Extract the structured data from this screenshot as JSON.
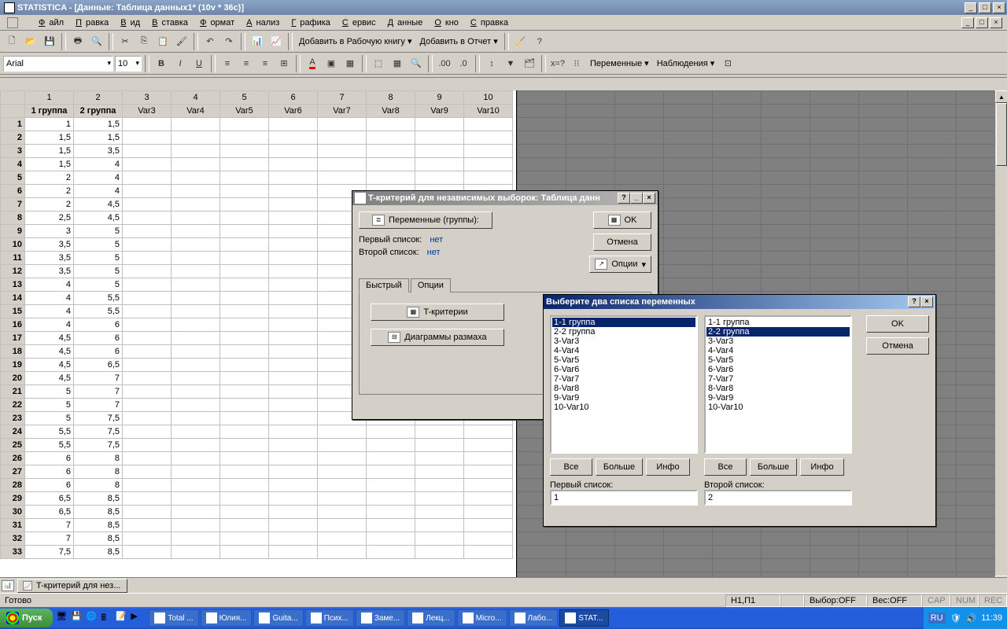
{
  "titlebar": "STATISTICA - [Данные: Таблица данных1* (10v * 36c)]",
  "menubar": [
    "Файл",
    "Правка",
    "Вид",
    "Вставка",
    "Формат",
    "Анализ",
    "Графика",
    "Сервис",
    "Данные",
    "Окно",
    "Справка"
  ],
  "toolbar1": {
    "add_workbook": "Добавить в Рабочую книгу",
    "add_report": "Добавить в Отчет"
  },
  "toolbar2": {
    "font": "Arial",
    "size": "10",
    "vars": "Переменные",
    "obs": "Наблюдения"
  },
  "columns_num": [
    "1",
    "2",
    "3",
    "4",
    "5",
    "6",
    "7",
    "8",
    "9",
    "10"
  ],
  "columns_name": [
    "1 группа",
    "2 группа",
    "Var3",
    "Var4",
    "Var5",
    "Var6",
    "Var7",
    "Var8",
    "Var9",
    "Var10"
  ],
  "rows": [
    [
      "1",
      "1",
      "1,5",
      "",
      "",
      "",
      "",
      "",
      "",
      "",
      ""
    ],
    [
      "2",
      "1,5",
      "1,5",
      "",
      "",
      "",
      "",
      "",
      "",
      "",
      ""
    ],
    [
      "3",
      "1,5",
      "3,5",
      "",
      "",
      "",
      "",
      "",
      "",
      "",
      ""
    ],
    [
      "4",
      "1,5",
      "4",
      "",
      "",
      "",
      "",
      "",
      "",
      "",
      ""
    ],
    [
      "5",
      "2",
      "4",
      "",
      "",
      "",
      "",
      "",
      "",
      "",
      ""
    ],
    [
      "6",
      "2",
      "4",
      "",
      "",
      "",
      "",
      "",
      "",
      "",
      ""
    ],
    [
      "7",
      "2",
      "4,5",
      "",
      "",
      "",
      "",
      "",
      "",
      "",
      ""
    ],
    [
      "8",
      "2,5",
      "4,5",
      "",
      "",
      "",
      "",
      "",
      "",
      "",
      ""
    ],
    [
      "9",
      "3",
      "5",
      "",
      "",
      "",
      "",
      "",
      "",
      "",
      ""
    ],
    [
      "10",
      "3,5",
      "5",
      "",
      "",
      "",
      "",
      "",
      "",
      "",
      ""
    ],
    [
      "11",
      "3,5",
      "5",
      "",
      "",
      "",
      "",
      "",
      "",
      "",
      ""
    ],
    [
      "12",
      "3,5",
      "5",
      "",
      "",
      "",
      "",
      "",
      "",
      "",
      ""
    ],
    [
      "13",
      "4",
      "5",
      "",
      "",
      "",
      "",
      "",
      "",
      "",
      ""
    ],
    [
      "14",
      "4",
      "5,5",
      "",
      "",
      "",
      "",
      "",
      "",
      "",
      ""
    ],
    [
      "15",
      "4",
      "5,5",
      "",
      "",
      "",
      "",
      "",
      "",
      "",
      ""
    ],
    [
      "16",
      "4",
      "6",
      "",
      "",
      "",
      "",
      "",
      "",
      "",
      ""
    ],
    [
      "17",
      "4,5",
      "6",
      "",
      "",
      "",
      "",
      "",
      "",
      "",
      ""
    ],
    [
      "18",
      "4,5",
      "6",
      "",
      "",
      "",
      "",
      "",
      "",
      "",
      ""
    ],
    [
      "19",
      "4,5",
      "6,5",
      "",
      "",
      "",
      "",
      "",
      "",
      "",
      ""
    ],
    [
      "20",
      "4,5",
      "7",
      "",
      "",
      "",
      "",
      "",
      "",
      "",
      ""
    ],
    [
      "21",
      "5",
      "7",
      "",
      "",
      "",
      "",
      "",
      "",
      "",
      ""
    ],
    [
      "22",
      "5",
      "7",
      "",
      "",
      "",
      "",
      "",
      "",
      "",
      ""
    ],
    [
      "23",
      "5",
      "7,5",
      "",
      "",
      "",
      "",
      "",
      "",
      "",
      ""
    ],
    [
      "24",
      "5,5",
      "7,5",
      "",
      "",
      "",
      "",
      "",
      "",
      "",
      ""
    ],
    [
      "25",
      "5,5",
      "7,5",
      "",
      "",
      "",
      "",
      "",
      "",
      "",
      ""
    ],
    [
      "26",
      "6",
      "8",
      "",
      "",
      "",
      "",
      "",
      "",
      "",
      ""
    ],
    [
      "27",
      "6",
      "8",
      "",
      "",
      "",
      "",
      "",
      "",
      "",
      ""
    ],
    [
      "28",
      "6",
      "8",
      "",
      "",
      "",
      "",
      "",
      "",
      "",
      ""
    ],
    [
      "29",
      "6,5",
      "8,5",
      "",
      "",
      "",
      "",
      "",
      "",
      "",
      ""
    ],
    [
      "30",
      "6,5",
      "8,5",
      "",
      "",
      "",
      "",
      "",
      "",
      "",
      ""
    ],
    [
      "31",
      "7",
      "8,5",
      "",
      "",
      "",
      "",
      "",
      "",
      "",
      ""
    ],
    [
      "32",
      "7",
      "8,5",
      "",
      "",
      "",
      "",
      "",
      "",
      "",
      ""
    ],
    [
      "33",
      "7,5",
      "8,5",
      "",
      "",
      "",
      "",
      "",
      "",
      "",
      ""
    ]
  ],
  "dialog1": {
    "title": "T-критерий для независимых выборок: Таблица данн",
    "vars_btn": "Переменные (группы):",
    "first": "Первый список:",
    "second": "Второй список:",
    "none": "нет",
    "ok": "OK",
    "cancel": "Отмена",
    "options": "Опции",
    "tab_quick": "Быстрый",
    "tab_opts": "Опции",
    "tcrit": "T-критерии",
    "boxplot": "Диаграммы размаха"
  },
  "dialog2": {
    "title": "Выберите два списка переменных",
    "ok": "OK",
    "cancel": "Отмена",
    "items": [
      "1-1 группа",
      "2-2 группа",
      "3-Var3",
      "4-Var4",
      "5-Var5",
      "6-Var6",
      "7-Var7",
      "8-Var8",
      "9-Var9",
      "10-Var10"
    ],
    "sel1_idx": 0,
    "sel2_idx": 1,
    "all": "Все",
    "more": "Больше",
    "info": "Инфо",
    "first_label": "Первый список:",
    "second_label": "Второй список:",
    "first_val": "1",
    "second_val": "2"
  },
  "mdi_tab": "T-критерий для нез...",
  "status": {
    "ready": "Готово",
    "pos": "Н1,П1",
    "sel": "Выбор:OFF",
    "weight": "Вес:OFF",
    "cap": "CAP",
    "num": "NUM",
    "rec": "REC"
  },
  "taskbar": {
    "start": "Пуск",
    "items": [
      "Total ...",
      "Юлия...",
      "Guita...",
      "Псих...",
      "Заме...",
      "Лекц...",
      "Micro...",
      "Лабо...",
      "STAT..."
    ],
    "lang": "RU",
    "time": "11:39"
  }
}
